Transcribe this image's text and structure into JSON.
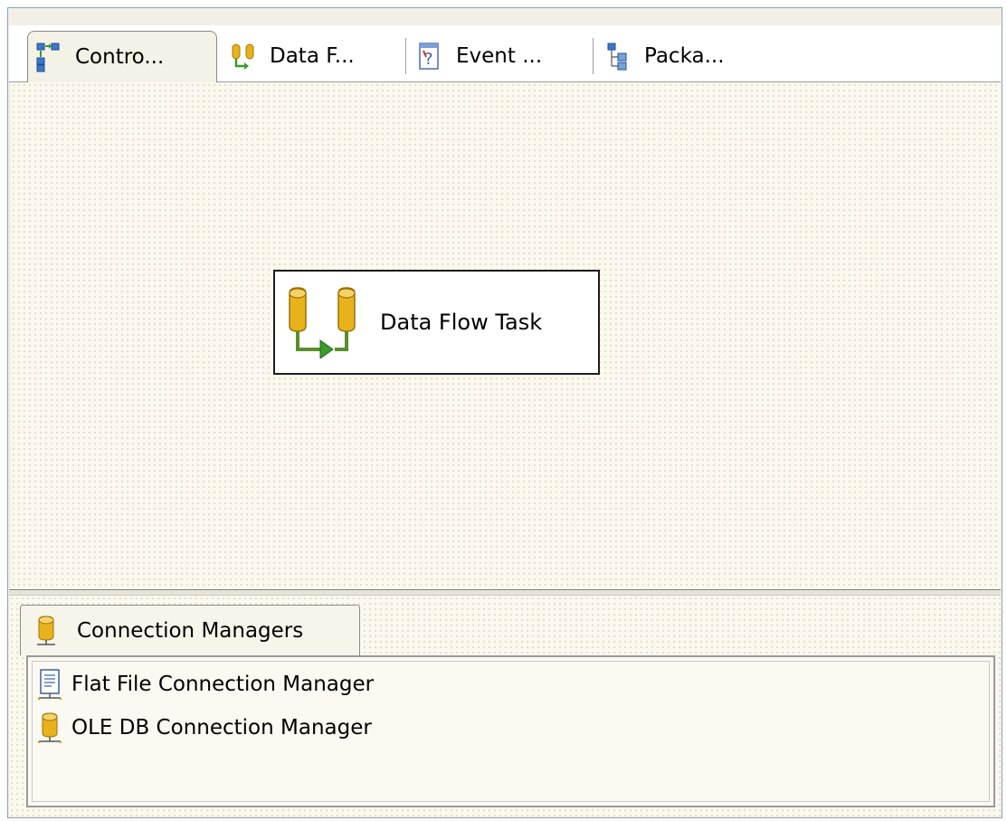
{
  "tabs": [
    {
      "label": "Contro...",
      "icon": "control-flow-icon",
      "active": true
    },
    {
      "label": "Data F...",
      "icon": "data-flow-icon",
      "active": false
    },
    {
      "label": "Event ...",
      "icon": "event-handlers-icon",
      "active": false
    },
    {
      "label": "Packa...",
      "icon": "package-explorer-icon",
      "active": false
    }
  ],
  "design_surface": {
    "task": {
      "label": "Data Flow Task",
      "icon": "data-flow-task-icon"
    }
  },
  "connection_managers": {
    "tab_label": "Connection Managers",
    "tab_icon": "database-icon",
    "items": [
      {
        "label": "Flat File Connection Manager",
        "icon": "flat-file-connection-icon"
      },
      {
        "label": "OLE DB Connection Manager",
        "icon": "oledb-connection-icon"
      }
    ]
  },
  "colors": {
    "cylinder": "#e8b21d",
    "arrow": "#3a9a2c",
    "tree_blue": "#3c78c8",
    "surface": "#fbf8ee"
  }
}
